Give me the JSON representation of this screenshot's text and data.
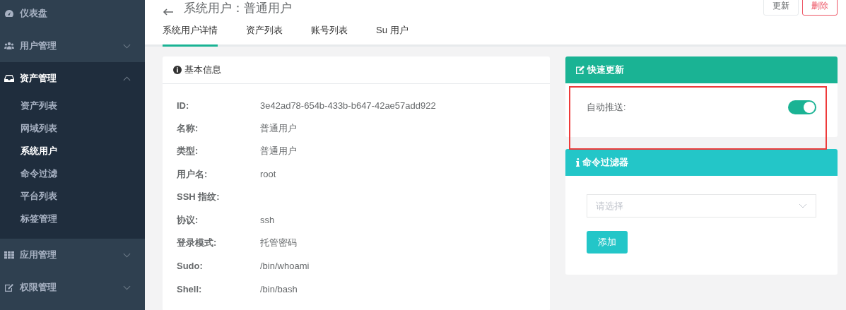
{
  "sidebar": {
    "items": [
      {
        "label": "仪表盘",
        "kind": "link",
        "expanded": false
      },
      {
        "label": "用户管理",
        "kind": "group",
        "expanded": false
      },
      {
        "label": "资产管理",
        "kind": "group",
        "expanded": true,
        "children": [
          {
            "label": "资产列表",
            "selected": false
          },
          {
            "label": "网域列表",
            "selected": false
          },
          {
            "label": "系统用户",
            "selected": true
          },
          {
            "label": "命令过滤",
            "selected": false
          },
          {
            "label": "平台列表",
            "selected": false
          },
          {
            "label": "标签管理",
            "selected": false
          }
        ]
      },
      {
        "label": "应用管理",
        "kind": "group",
        "expanded": false
      },
      {
        "label": "权限管理",
        "kind": "group",
        "expanded": false
      }
    ]
  },
  "header": {
    "title": "系统用户：普通用户",
    "buttons": [
      {
        "label": "更新",
        "kind": "default"
      },
      {
        "label": "删除",
        "kind": "danger"
      }
    ]
  },
  "tabs": [
    {
      "label": "系统用户详情",
      "selected": true
    },
    {
      "label": "资产列表",
      "selected": false
    },
    {
      "label": "账号列表",
      "selected": false
    },
    {
      "label": "Su 用户",
      "selected": false
    }
  ],
  "basic_info": {
    "title": "基本信息",
    "rows": [
      {
        "label": "ID:",
        "value": "3e42ad78-654b-433b-b647-42ae57add922"
      },
      {
        "label": "名称:",
        "value": "普通用户"
      },
      {
        "label": "类型:",
        "value": "普通用户"
      },
      {
        "label": "用户名:",
        "value": "root"
      },
      {
        "label": "SSH 指纹:"
      },
      {
        "label": "协议:",
        "value": "ssh"
      },
      {
        "label": "登录模式:",
        "value": "托管密码"
      },
      {
        "label": "Sudo:",
        "value": "/bin/whoami"
      },
      {
        "label": "Shell:",
        "value": "/bin/bash"
      }
    ]
  },
  "quick_update": {
    "title": "快速更新",
    "highlighted": true,
    "rows": [
      {
        "label": "自动推送:",
        "on": true
      }
    ]
  },
  "command_filter": {
    "title": "命令过滤器",
    "select": {
      "placeholder": "请选择"
    },
    "button": "添加"
  }
}
